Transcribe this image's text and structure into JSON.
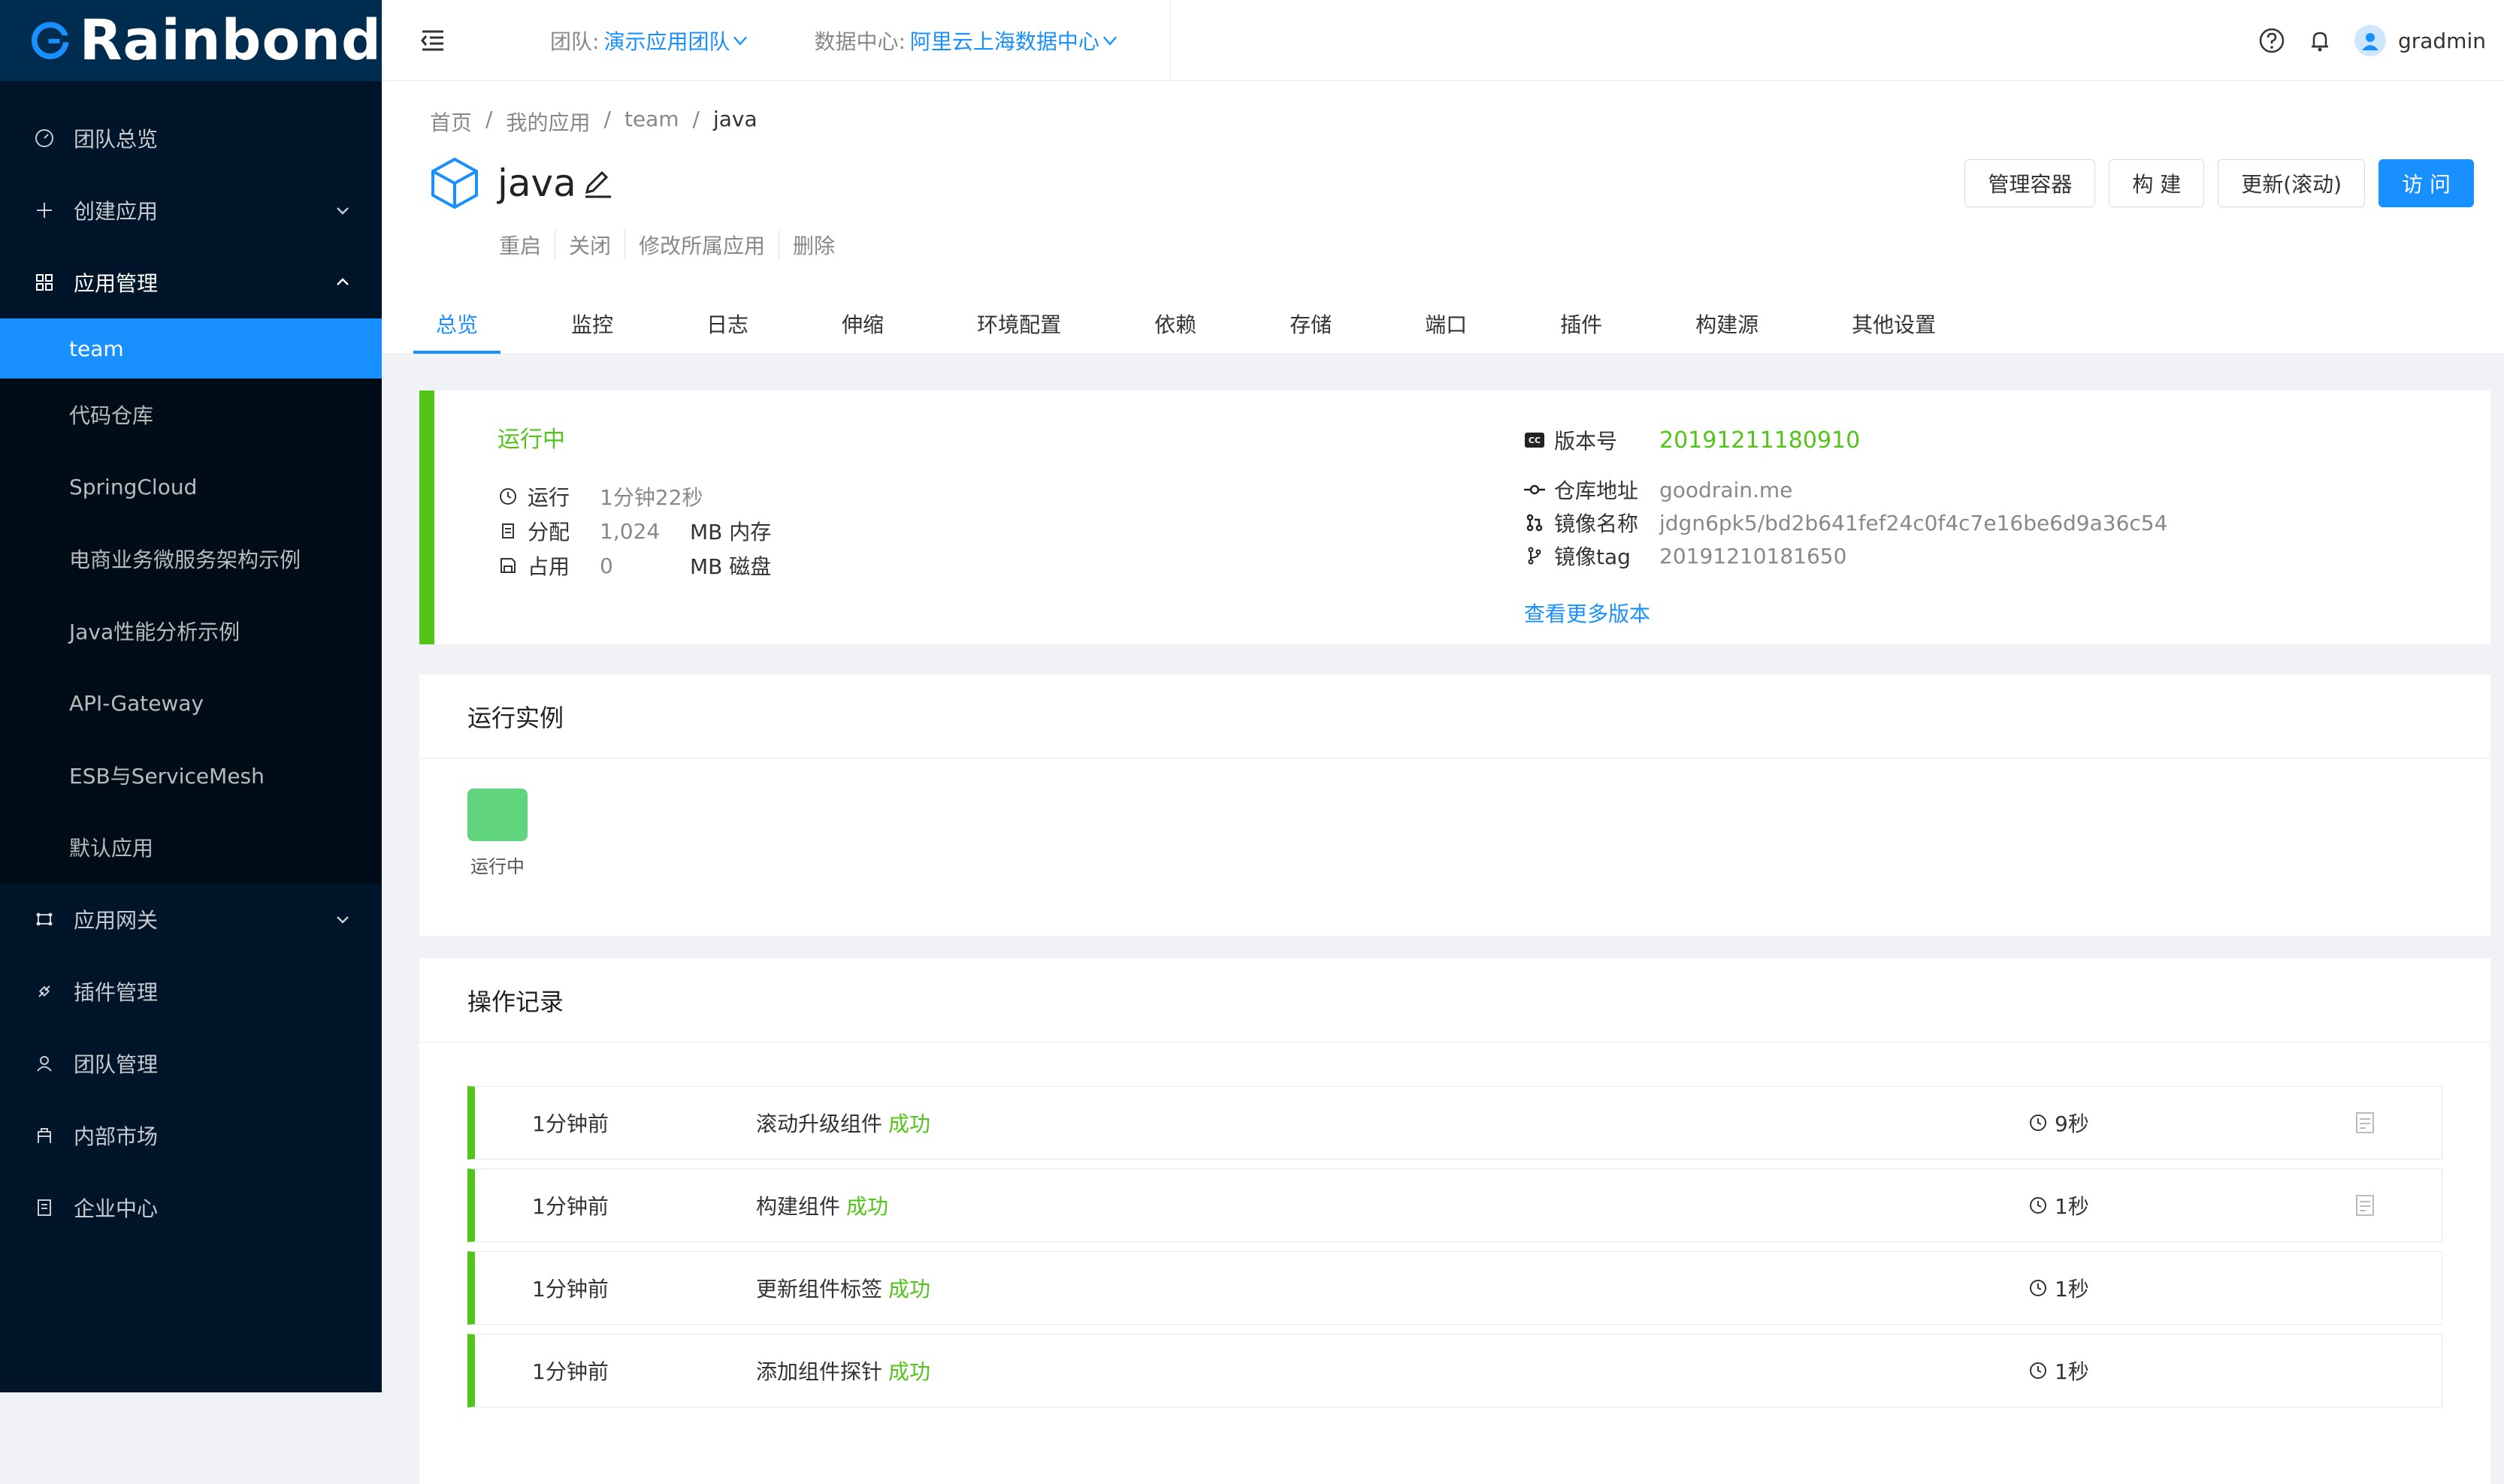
{
  "brand": {
    "name": "Rainbond"
  },
  "sidebar": {
    "items": [
      {
        "label": "团队总览",
        "icon": "dashboard-icon"
      },
      {
        "label": "创建应用",
        "icon": "plus-icon",
        "expand": "down"
      },
      {
        "label": "应用管理",
        "icon": "appstore-icon",
        "expand": "up"
      },
      {
        "label": "应用网关",
        "icon": "gateway-icon",
        "expand": "down"
      },
      {
        "label": "插件管理",
        "icon": "api-icon"
      },
      {
        "label": "团队管理",
        "icon": "team-icon"
      },
      {
        "label": "内部市场",
        "icon": "shop-icon"
      },
      {
        "label": "企业中心",
        "icon": "enterprise-icon"
      }
    ],
    "submenu": [
      "team",
      "代码仓库",
      "SpringCloud",
      "电商业务微服务架构示例",
      "Java性能分析示例",
      "API-Gateway",
      "ESB与ServiceMesh",
      "默认应用"
    ]
  },
  "header": {
    "team_label": "团队:",
    "team_value": "演示应用团队",
    "dc_label": "数据中心:",
    "dc_value": "阿里云上海数据中心",
    "username": "gradmin"
  },
  "breadcrumb": [
    "首页",
    "我的应用",
    "team",
    "java"
  ],
  "app": {
    "name": "java",
    "actions": [
      "重启",
      "关闭",
      "修改所属应用",
      "删除"
    ],
    "buttons": [
      "管理容器",
      "构 建",
      "更新(滚动)",
      "访 问"
    ]
  },
  "tabs": [
    "总览",
    "监控",
    "日志",
    "伸缩",
    "环境配置",
    "依赖",
    "存储",
    "端口",
    "插件",
    "构建源",
    "其他设置"
  ],
  "status": {
    "title": "运行中",
    "run_label": "运行",
    "run_value": "1分钟22秒",
    "alloc_label": "分配",
    "alloc_value": "1,024",
    "alloc_unit": "MB 内存",
    "disk_label": "占用",
    "disk_value": "0",
    "disk_unit": "MB 磁盘",
    "version_label": "版本号",
    "version_value": "20191211180910",
    "repo_label": "仓库地址",
    "repo_value": "goodrain.me",
    "image_label": "镜像名称",
    "image_value": "jdgn6pk5/bd2b641fef24c0f4c7e16be6d9a36c54",
    "tag_label": "镜像tag",
    "tag_value": "20191210181650",
    "more_versions": "查看更多版本"
  },
  "instances": {
    "title": "运行实例",
    "items": [
      {
        "label": "运行中"
      }
    ]
  },
  "logs": {
    "title": "操作记录",
    "rows": [
      {
        "time": "1分钟前",
        "desc": "滚动升级组件",
        "result": "成功",
        "duration": "9秒"
      },
      {
        "time": "1分钟前",
        "desc": "构建组件",
        "result": "成功",
        "duration": "1秒"
      },
      {
        "time": "1分钟前",
        "desc": "更新组件标签",
        "result": "成功",
        "duration": "1秒"
      },
      {
        "time": "1分钟前",
        "desc": "添加组件探针",
        "result": "成功",
        "duration": "1秒"
      }
    ]
  },
  "colors": {
    "primary": "#1890ff",
    "success": "#52c41a",
    "sidebar": "#001529"
  }
}
